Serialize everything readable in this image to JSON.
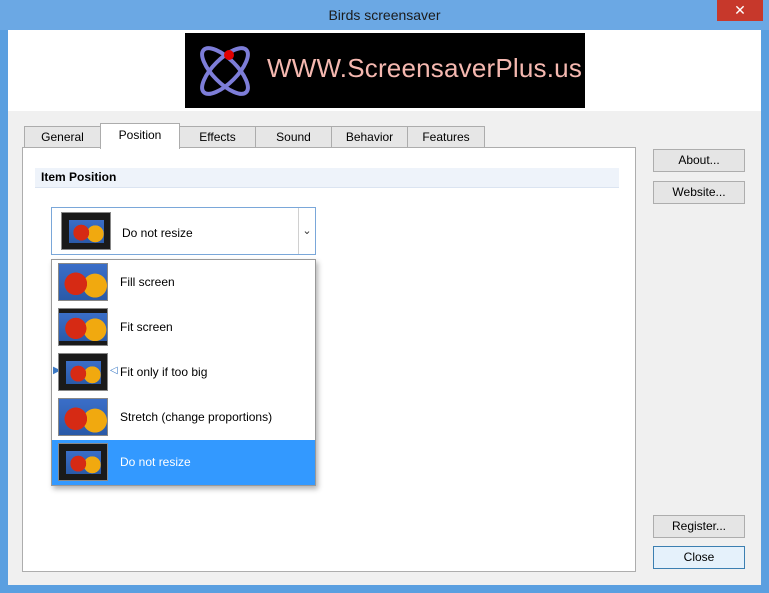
{
  "window": {
    "title": "Birds screensaver",
    "close_glyph": "✕"
  },
  "banner": {
    "text": "WWW.ScreensaverPlus.us",
    "icon": "atom-logo"
  },
  "tabs": [
    {
      "label": "General"
    },
    {
      "label": "Position"
    },
    {
      "label": "Effects"
    },
    {
      "label": "Sound"
    },
    {
      "label": "Behavior"
    },
    {
      "label": "Features"
    }
  ],
  "active_tab": "Position",
  "section": {
    "title": "Item Position"
  },
  "combo": {
    "selected": "Do not resize",
    "arrow_glyph": "⌄"
  },
  "options": [
    {
      "label": "Fill screen"
    },
    {
      "label": "Fit screen"
    },
    {
      "label": "Fit only if too big"
    },
    {
      "label": "Stretch (change proportions)"
    },
    {
      "label": "Do not resize"
    }
  ],
  "buttons": {
    "about": "About...",
    "website": "Website...",
    "register": "Register...",
    "close": "Close"
  },
  "colors": {
    "selection": "#3399ff",
    "title_bar": "#6ba8e4",
    "close": "#c7382b"
  }
}
